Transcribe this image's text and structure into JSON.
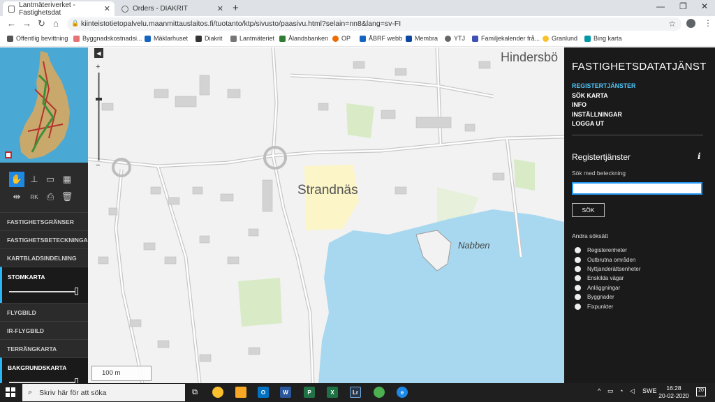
{
  "browser": {
    "tabs": [
      {
        "title": "Lantmäteriverket - Fastighetsdat",
        "active": true
      },
      {
        "title": "Orders - DIAKRIT",
        "active": false
      }
    ],
    "url": "kiinteistotietopalvelu.maanmittauslaitos.fi/tuotanto/ktp/sivusto/paasivu.html?selain=nn8&lang=sv-FI",
    "bookmarks": [
      "Offentlig bevittning",
      "Byggnadskostnadsi...",
      "Mäklarhuset",
      "Diakrit",
      "Lantmäteriet",
      "Ålandsbanken",
      "OP",
      "ÅBRF webb",
      "Membra",
      "YTJ",
      "Familjekalender frå...",
      "Granlund",
      "Bing karta"
    ]
  },
  "left": {
    "layers": [
      "FASTIGHETSGRÄNSER",
      "FASTIGHETSBETECKNINGAR",
      "KARTBLADSINDELNING"
    ],
    "active_layer": "STOMKARTA",
    "layers2": [
      "FLYGBILD",
      "IR-FLYGBILD",
      "TERRÄNGKARTA"
    ],
    "active_layer2": "BAKGRUNDSKARTA",
    "tool_icons": [
      "hand-icon",
      "pin-icon",
      "ruler-icon",
      "area-icon",
      "move-icon",
      "rk-icon",
      "print-icon",
      "trash-icon"
    ]
  },
  "map": {
    "labels": {
      "place1": "Hindersbö",
      "place2": "Strandnäs",
      "place3": "Nabben"
    },
    "scale": "100 m",
    "colors": {
      "water": "#a8d8f0",
      "land": "#f2f2f2",
      "park": "#d8ebc6",
      "yellow": "#fbf5c8"
    }
  },
  "right": {
    "title": "FASTIGHETSDATATJÄNST",
    "menu": [
      "REGISTERTJÄNSTER",
      "SÖK KARTA",
      "INFO",
      "INSTÄLLNINGAR",
      "LOGGA UT"
    ],
    "section_title": "Registertjänster",
    "search_label": "Sök med beteckning",
    "search_value": "",
    "search_button": "SÖK",
    "other_title": "Andra söksätt",
    "options": [
      "Registerenheter",
      "Outbrutna områden",
      "Nyttjanderättsenheter",
      "Enskilda vägar",
      "Anläggningar",
      "Byggnader",
      "Fixpunkter"
    ]
  },
  "taskbar": {
    "search_placeholder": "Skriv här för att söka",
    "lang": "SWE",
    "time": "16:28",
    "date": "20-02-2020",
    "notifications": "20"
  }
}
